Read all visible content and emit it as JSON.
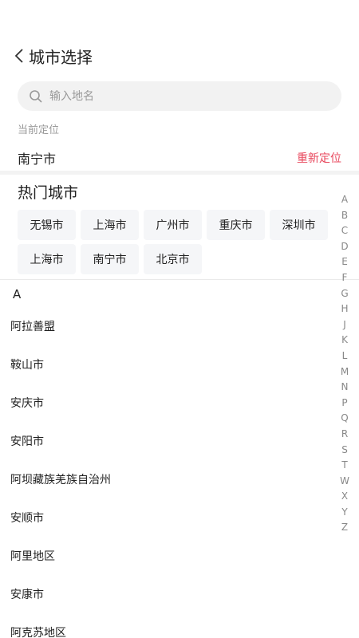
{
  "header": {
    "title": "城市选择",
    "back_icon": "chevron-left-icon"
  },
  "search": {
    "placeholder": "输入地名",
    "icon": "search-icon"
  },
  "location": {
    "label": "当前定位",
    "city": "南宁市",
    "relocate": "重新定位"
  },
  "hot": {
    "title": "热门城市",
    "cities": [
      "无锡市",
      "上海市",
      "广州市",
      "重庆市",
      "深圳市",
      "上海市",
      "南宁市",
      "北京市"
    ]
  },
  "section": {
    "letter": "A"
  },
  "cities": [
    "阿拉善盟",
    "鞍山市",
    "安庆市",
    "安阳市",
    "阿坝藏族羌族自治州",
    "安顺市",
    "阿里地区",
    "安康市",
    "阿克苏地区"
  ],
  "index_letters": [
    "A",
    "B",
    "C",
    "D",
    "E",
    "F",
    "G",
    "H",
    "J",
    "K",
    "L",
    "M",
    "N",
    "P",
    "Q",
    "R",
    "S",
    "T",
    "W",
    "X",
    "Y",
    "Z"
  ],
  "colors": {
    "accent": "#e8475c",
    "chip_bg": "#f5f6f8",
    "search_bg": "#f2f2f2"
  }
}
